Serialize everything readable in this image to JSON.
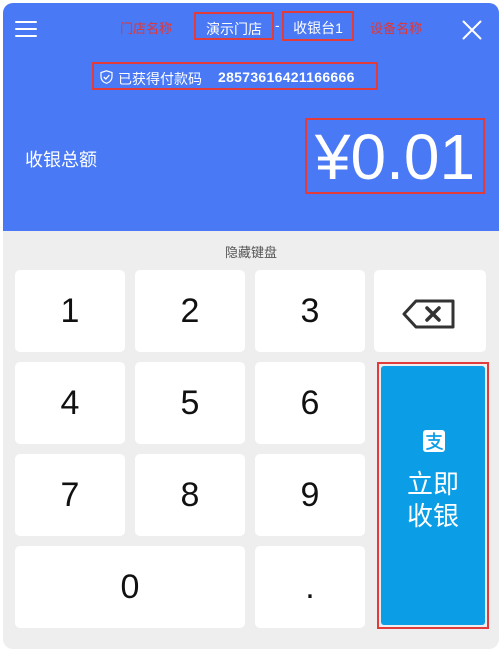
{
  "header": {
    "store_annotation": "门店名称",
    "store_name": "演示门店",
    "separator": "-",
    "device_name": "收银台1",
    "device_annotation": "设备名称",
    "payee_label": "已获得付款码",
    "payee_code": "28573616421166666",
    "total_label": "收银总额",
    "amount": "¥0.01"
  },
  "keypad": {
    "hide_label": "隐藏键盘",
    "keys": [
      "1",
      "2",
      "3",
      "4",
      "5",
      "6",
      "7",
      "8",
      "9",
      "0",
      "."
    ],
    "submit_label_line1": "立即",
    "submit_label_line2": "收银"
  },
  "colors": {
    "header_bg": "#4a79f6",
    "submit_bg": "#0b9de6",
    "annotation": "#e8342c",
    "keypad_bg": "#eeeeee"
  }
}
